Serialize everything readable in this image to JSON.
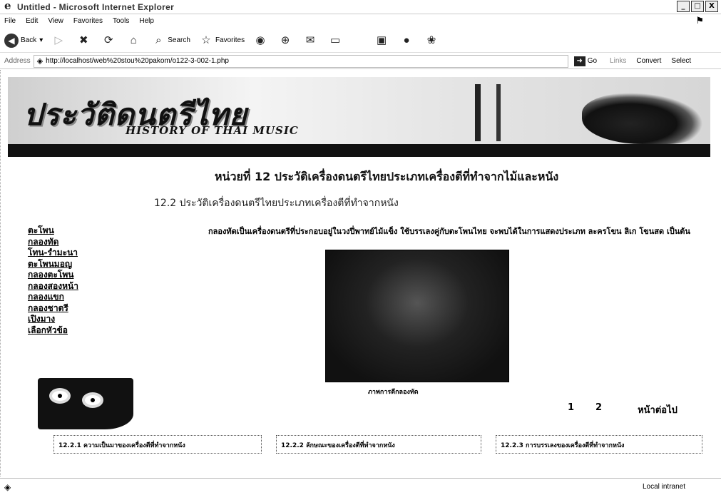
{
  "window": {
    "title": "Untitled - Microsoft Internet Explorer",
    "controls": [
      "_",
      "□",
      "X"
    ]
  },
  "menu": [
    "File",
    "Edit",
    "View",
    "Favorites",
    "Tools",
    "Help"
  ],
  "toolbar": {
    "back": "Back",
    "search": "Search",
    "favorites": "Favorites"
  },
  "address": {
    "label": "Address",
    "url": "http://localhost/web%20stou%20pakom/o122-3-002-1.php",
    "go": "Go",
    "links": "Links",
    "convert": "Convert",
    "select": "Select"
  },
  "banner": {
    "title": "ประวัติดนตรีไทย",
    "subtitle": "HISTORY OF THAI MUSIC"
  },
  "content": {
    "unit_heading": "หน่วยที่ 12 ประวัติเครื่องดนตรีไทยประเภทเครื่องตีที่ทำจากไม้และหนัง",
    "sub_heading": "12.2 ประวัติเครื่องดนตรีไทยประเภทเครื่องตีที่ทำจากหนัง",
    "paragraph": "กลองทัดเป็นเครื่องดนตรีที่ประกอบอยู่ในวงปี่พาทย์ไม้แข็ง ใช้บรรเลงคู่กับตะโพนไทย จะพบได้ในการแสดงประเภท ละครโขน ลิเก โขนสด เป็นต้น",
    "photo_caption": "ภาพการตีกลองทัด"
  },
  "sidebar": {
    "items": [
      "ตะโพน",
      "กลองทัด",
      "โทน-รำมะนา",
      "ตะโพนมอญ",
      "กลองตะโพน",
      "กลองสองหน้า",
      "กลองแขก",
      "กลองชาตรี",
      "เปิงมาง",
      "เลือกหัวข้อ"
    ]
  },
  "pager": {
    "page1": "1",
    "page2": "2",
    "next": "หน้าต่อไป"
  },
  "bottom_links": [
    "12.2.1 ความเป็นมาของเครื่องตีที่ทำจากหนัง",
    "12.2.2 ลักษณะของเครื่องตีที่ทำจากหนัง",
    "12.2.3 การบรรเลงของเครื่องตีที่ทำจากหนัง"
  ],
  "status": {
    "zone": "Local intranet"
  }
}
